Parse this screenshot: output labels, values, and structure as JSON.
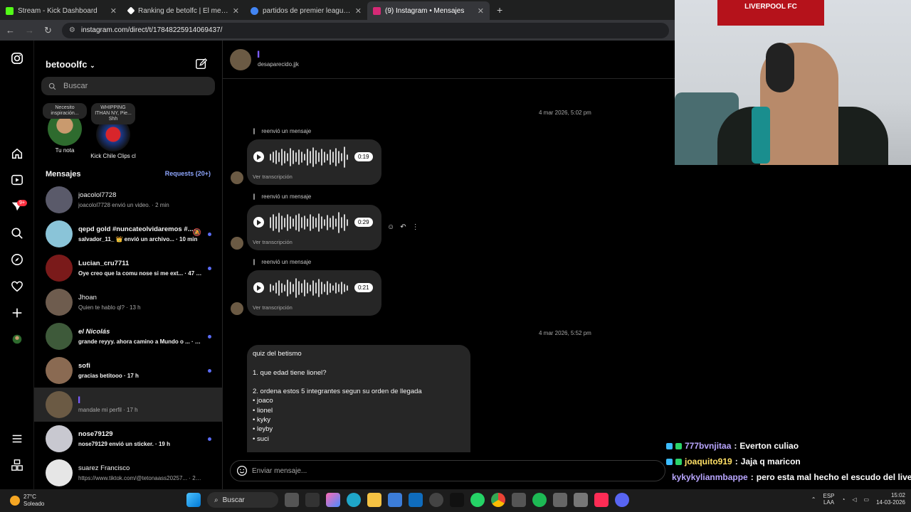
{
  "browser": {
    "tabs": [
      {
        "title": "Stream - Kick Dashboard",
        "color": "#53fc18"
      },
      {
        "title": "Ranking de betolfc | El mejor sc",
        "color": "#ffffff"
      },
      {
        "title": "partidos de premier league - B",
        "color": "#4285f4"
      },
      {
        "title": "(9) Instagram • Mensajes",
        "color": "#d62976"
      }
    ],
    "url": "instagram.com/direct/t/17848225914069437/"
  },
  "inbox": {
    "username": "betooolfc",
    "search_placeholder": "Buscar",
    "notes": [
      {
        "bubble": "Necesito inspiración...",
        "caption": "Tu nota"
      },
      {
        "bubble": "WHIPPING ITHAN NY, Pie... Shh",
        "caption": "Kick Chile Clips cl"
      }
    ],
    "section_title": "Mensajes",
    "requests": "Requests (20+)",
    "conversations": [
      {
        "name": "joacolol7728",
        "preview": "joacolol7728 envió un video. · 2 min",
        "unread": false,
        "color": "#5a5a6a"
      },
      {
        "name": "qepd gold #nuncateolvidaremos #...",
        "preview": "salvador_11_ 👑 envió un archivo... · 10 min",
        "unread": true,
        "color": "#8ac4d8"
      },
      {
        "name": "Lucian_cru7711",
        "preview": "Oye creo que la comu nose si me ext... · 47 min",
        "unread": true,
        "color": "#7a1a1a"
      },
      {
        "name": "Jhoan",
        "preview": "Quien te hablo ql? · 13 h",
        "unread": false,
        "color": "#6e5c4e"
      },
      {
        "name": "el Nicolás",
        "preview": "grande reyyy. ahora camino a Mundo o ... · 15 h",
        "unread": true,
        "color": "#3e5a3a"
      },
      {
        "name": "sofi",
        "preview": "gracias betitooo · 17 h",
        "unread": true,
        "color": "#8a6a52"
      },
      {
        "name": "",
        "preview": "mandale mi perfil · 17 h",
        "unread": false,
        "color": "#6b5a44"
      },
      {
        "name": "nose79129",
        "preview": "nose79129 envió un sticker. · 19 h",
        "unread": true,
        "color": "#c8c8d0"
      },
      {
        "name": "suarez Francisco",
        "preview": "https://www.tiktok.com/@tetonaass20257... · 20 h",
        "unread": false,
        "color": "#e6e6e6"
      }
    ]
  },
  "chat": {
    "contact": "desaparecido.jjk",
    "stamp1": "4 mar 2026, 5:02 pm",
    "stamp2": "4 mar 2026, 5:52 pm",
    "forwarded_label": "reenvió un mensaje",
    "transcript_label": "Ver transcripción",
    "voice": [
      "0:19",
      "0:29",
      "0:21"
    ],
    "quiz": "quiz del betismo\n\n1. que edad tiene lionel?\n\n2. ordena estos 5 integrantes segun su orden de llegada\n• joaco\n• lionel\n• kyky\n• leyby\n• suci",
    "composer_placeholder": "Enviar mensaje..."
  },
  "cam": {
    "banner": "LIVERPOOL FC"
  },
  "stream_chat": [
    {
      "user": "777bvnjitaa",
      "msg": "Everton culiao",
      "color": "#b9a6ff"
    },
    {
      "user": "joaquito919",
      "msg": "Jaja q maricon",
      "color": "#ffe066"
    },
    {
      "user": "kykykylianmbappe",
      "msg": "pero esta mal hecho el escudo del live",
      "color": "#b9a6ff"
    }
  ],
  "taskbar": {
    "temp": "27°C",
    "weather": "Soleado",
    "search": "Buscar",
    "lang": "ESP",
    "lang2": "LAA",
    "time": "15:02",
    "date": "14-03-2026"
  }
}
